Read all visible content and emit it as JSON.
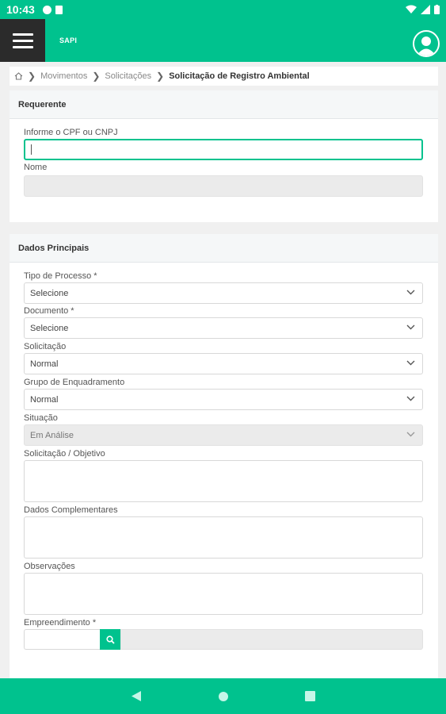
{
  "status_bar": {
    "time": "10:43"
  },
  "app": {
    "brand": "SAPI"
  },
  "breadcrumb": {
    "items": [
      "Movimentos",
      "Solicitações"
    ],
    "current": "Solicitação de Registro Ambiental"
  },
  "requerente": {
    "title": "Requerente",
    "cpf_label": "Informe o CPF ou CNPJ",
    "cpf_value": "",
    "nome_label": "Nome",
    "nome_value": ""
  },
  "dados": {
    "title": "Dados Principais",
    "tipo_label": "Tipo de Processo *",
    "tipo_value": "Selecione",
    "documento_label": "Documento *",
    "documento_value": "Selecione",
    "solicitacao_label": "Solicitação",
    "solicitacao_value": "Normal",
    "grupo_label": "Grupo de Enquadramento",
    "grupo_value": "Normal",
    "situacao_label": "Situação",
    "situacao_value": "Em Análise",
    "objetivo_label": "Solicitação / Objetivo",
    "complementares_label": "Dados Complementares",
    "observacoes_label": "Observações",
    "empreendimento_label": "Empreendimento *"
  },
  "colors": {
    "accent": "#00c28e",
    "menu_bg": "#2b2b2b"
  },
  "icons": [
    "menu-icon",
    "user-avatar-icon",
    "home-icon",
    "chevron-right-icon",
    "chevron-down-icon",
    "search-icon",
    "back-icon",
    "home-nav-icon",
    "recents-icon"
  ]
}
